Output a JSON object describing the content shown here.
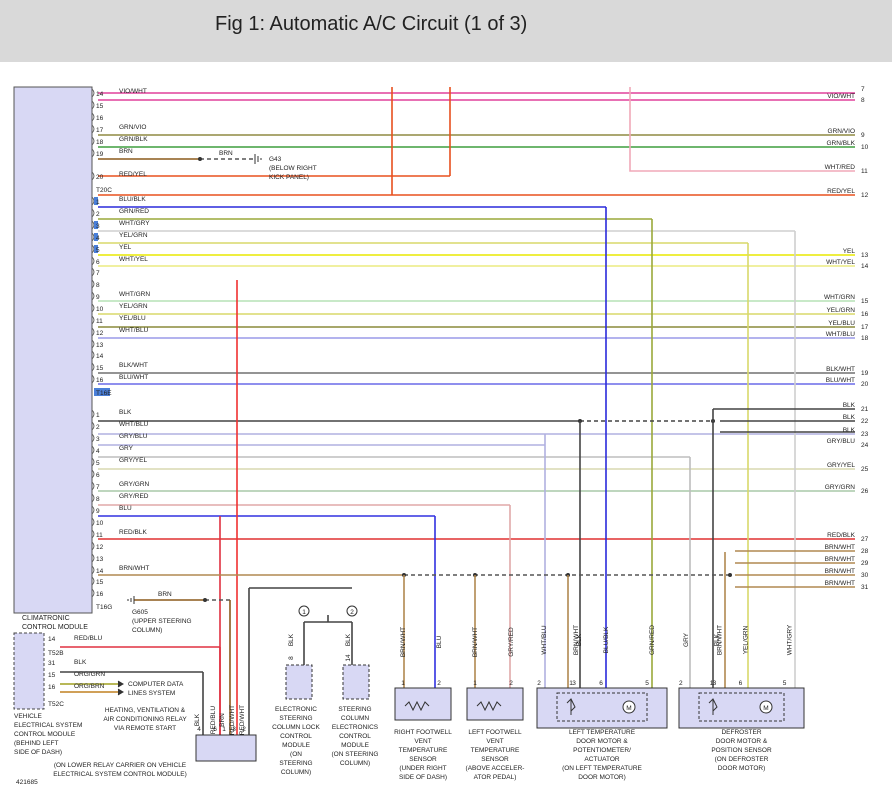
{
  "title": "Fig 1: Automatic A/C Circuit (1 of 3)",
  "figure_id": "421685",
  "colors": {
    "VIO/WHT": "#e0409c",
    "GRN/VIO": "#8f8a42",
    "GRN/BLK": "#3e9e3e",
    "BRN": "#8b5a1b",
    "RED/YEL": "#e8501e",
    "WHT/RED": "#f0a8b8",
    "BLU/BLK": "#2a2adb",
    "GRN/RED": "#9aa83a",
    "WHT/GRY": "#cfcfcf",
    "YEL/GRN": "#d8d86a",
    "YEL": "#e8e800",
    "WHT/YEL": "#ecec80",
    "WHT/GRN": "#b6e2b6",
    "YEL/GRY": "#d8d8a0",
    "YEL/BLU": "#8a8a3a",
    "WHT/BLU": "#9a9ae8",
    "BLK/WHT": "#707070",
    "BLU/WHT": "#6a6ae8",
    "BLK": "#444444",
    "GRY/BLU": "#b0b0e0",
    "GRY": "#bdbdbd",
    "GRY/YEL": "#d8d8b0",
    "GRY/GRN": "#a8c8a8",
    "GRY/RED": "#e0a8a8",
    "BLU": "#3030e0",
    "RED/BLK": "#e03030",
    "BRN/WHT": "#b08850",
    "RED/BLU": "#e03040",
    "RED/WHT": "#f03030",
    "ORG/GRN": "#a0a020",
    "ORG/BRN": "#c08020"
  },
  "module": {
    "name": [
      "CLIMATRONIC",
      "CONTROL MODULE"
    ],
    "connectors": [
      "T20C",
      "T16E",
      "T16G"
    ]
  },
  "left_pins": [
    {
      "pin": "14",
      "label": "VIO/WHT"
    },
    {
      "pin": "15",
      "label": ""
    },
    {
      "pin": "16",
      "label": ""
    },
    {
      "pin": "17",
      "label": "GRN/VIO"
    },
    {
      "pin": "18",
      "label": "GRN/BLK"
    },
    {
      "pin": "19",
      "label": "BRN"
    },
    {
      "pin": "20",
      "label": "RED/YEL"
    },
    {
      "pin": "1",
      "label": "BLU/BLK"
    },
    {
      "pin": "2",
      "label": "GRN/RED"
    },
    {
      "pin": "3",
      "label": "WHT/GRY"
    },
    {
      "pin": "4",
      "label": "YEL/GRN"
    },
    {
      "pin": "5",
      "label": "YEL"
    },
    {
      "pin": "6",
      "label": "WHT/YEL"
    },
    {
      "pin": "7",
      "label": ""
    },
    {
      "pin": "8",
      "label": ""
    },
    {
      "pin": "9",
      "label": "WHT/GRN"
    },
    {
      "pin": "10",
      "label": "YEL/GRN"
    },
    {
      "pin": "11",
      "label": "YEL/BLU"
    },
    {
      "pin": "12",
      "label": "WHT/BLU"
    },
    {
      "pin": "13",
      "label": ""
    },
    {
      "pin": "14",
      "label": ""
    },
    {
      "pin": "15",
      "label": "BLK/WHT"
    },
    {
      "pin": "16",
      "label": "BLU/WHT"
    },
    {
      "pin": "1",
      "label": "BLK"
    },
    {
      "pin": "2",
      "label": "WHT/BLU"
    },
    {
      "pin": "3",
      "label": "GRY/BLU"
    },
    {
      "pin": "4",
      "label": "GRY"
    },
    {
      "pin": "5",
      "label": "GRY/YEL"
    },
    {
      "pin": "6",
      "label": ""
    },
    {
      "pin": "7",
      "label": "GRY/GRN"
    },
    {
      "pin": "8",
      "label": "GRY/RED"
    },
    {
      "pin": "9",
      "label": "BLU"
    },
    {
      "pin": "10",
      "label": ""
    },
    {
      "pin": "11",
      "label": "RED/BLK"
    },
    {
      "pin": "12",
      "label": ""
    },
    {
      "pin": "13",
      "label": ""
    },
    {
      "pin": "14",
      "label": "BRN/WHT"
    },
    {
      "pin": "15",
      "label": ""
    },
    {
      "pin": "16",
      "label": ""
    }
  ],
  "right_refs": [
    {
      "num": "7",
      "label": ""
    },
    {
      "num": "8",
      "label": "VIO/WHT"
    },
    {
      "num": "9",
      "label": "GRN/VIO"
    },
    {
      "num": "10",
      "label": "GRN/BLK"
    },
    {
      "num": "11",
      "label": "WHT/RED"
    },
    {
      "num": "12",
      "label": "RED/YEL"
    },
    {
      "num": "13",
      "label": "YEL"
    },
    {
      "num": "14",
      "label": "WHT/YEL"
    },
    {
      "num": "15",
      "label": "WHT/GRN"
    },
    {
      "num": "16",
      "label": "YEL/GRN"
    },
    {
      "num": "17",
      "label": "YEL/BLU"
    },
    {
      "num": "18",
      "label": "WHT/BLU"
    },
    {
      "num": "19",
      "label": "BLK/WHT"
    },
    {
      "num": "20",
      "label": "BLU/WHT"
    },
    {
      "num": "21",
      "label": "BLK"
    },
    {
      "num": "22",
      "label": "BLK"
    },
    {
      "num": "23",
      "label": "BLK"
    },
    {
      "num": "24",
      "label": "GRY/BLU"
    },
    {
      "num": "25",
      "label": "GRY/YEL"
    },
    {
      "num": "26",
      "label": "GRY/GRN"
    },
    {
      "num": "27",
      "label": "RED/BLK"
    },
    {
      "num": "28",
      "label": "BRN/WHT"
    },
    {
      "num": "29",
      "label": "BRN/WHT"
    },
    {
      "num": "30",
      "label": "BRN/WHT"
    },
    {
      "num": "31",
      "label": "BRN/WHT"
    }
  ],
  "grounds": {
    "g43": {
      "wire": "BRN",
      "name": "G43",
      "location": [
        "(BELOW RIGHT",
        "KICK PANEL)"
      ]
    },
    "g605": {
      "wire": "BRN",
      "name": "G605",
      "location": [
        "(UPPER STEERING",
        "COLUMN)"
      ]
    }
  },
  "vecm": {
    "connectors": [
      "T52B",
      "T52C"
    ],
    "pins": [
      {
        "pin": "14",
        "label": "RED/BLU"
      },
      {
        "pin": "31",
        "label": "BLK"
      },
      {
        "pin": "15",
        "label": "ORG/GRN"
      },
      {
        "pin": "16",
        "label": "ORG/BRN"
      }
    ],
    "data_lines": "COMPUTER DATA LINES SYSTEM",
    "name": [
      "VEHICLE",
      "ELECTRICAL SYSTEM",
      "CONTROL MODULE",
      "(BEHIND LEFT",
      "SIDE OF DASH)"
    ]
  },
  "hvac_relay": {
    "pins": [
      {
        "pin": "4",
        "wire": "BLK"
      },
      {
        "pin": "6",
        "wire": "RED/BLU"
      },
      {
        "pin": "1",
        "wire": "BRN"
      },
      {
        "pin": "3",
        "wire": "RED/WHT"
      },
      {
        "pin": "2",
        "wire": "RED/WHT"
      }
    ],
    "name": [
      "HEATING, VENTILATION &",
      "AIR CONDITIONING RELAY",
      "VIA REMOTE START",
      "(ON LOWER RELAY CARRIER ON VEHICLE",
      "ELECTRICAL SYSTEM CONTROL MODULE)"
    ]
  },
  "steering_lock": {
    "pin": "8",
    "wire": "BLK",
    "name": [
      "ELECTRONIC",
      "STEERING",
      "COLUMN LOCK",
      "CONTROL",
      "MODULE",
      "(ON",
      "STEERING",
      "COLUMN)"
    ]
  },
  "steering_elec": {
    "pin": "14",
    "wire": "BLK",
    "name": [
      "STEERING",
      "COLUMN",
      "ELECTRONICS",
      "CONTROL",
      "MODULE",
      "(ON STEERING",
      "COLUMN)"
    ]
  },
  "splice_markers": [
    "1",
    "2"
  ],
  "right_vent": {
    "pins": [
      "1",
      "2"
    ],
    "wires": [
      "BRN/WHT",
      "BLU"
    ],
    "name": [
      "RIGHT FOOTWELL",
      "VENT",
      "TEMPERATURE",
      "SENSOR",
      "(UNDER RIGHT",
      "SIDE OF DASH)"
    ]
  },
  "left_vent": {
    "pins": [
      "1",
      "2"
    ],
    "wires": [
      "BRN/WHT",
      "GRY/RED"
    ],
    "name": [
      "LEFT FOOTWELL",
      "VENT",
      "TEMPERATURE",
      "SENSOR",
      "(ABOVE ACCELER-",
      "ATOR PEDAL)"
    ]
  },
  "left_temp_motor": {
    "pins": [
      "2",
      "1",
      "3",
      "6",
      "5"
    ],
    "wires": [
      "WHT/BLU",
      "BRN/WHT",
      "BLK",
      "BLU/BLK",
      "GRN/RED"
    ],
    "name": [
      "LEFT TEMPERATURE",
      "DOOR MOTOR &",
      "POTENTIOMETER/",
      "ACTUATOR",
      "(ON LEFT TEMPERATURE",
      "DOOR MOTOR)"
    ]
  },
  "defroster_motor": {
    "pins": [
      "2",
      "1",
      "3",
      "6",
      "5"
    ],
    "wires": [
      "GRY",
      "BLK",
      "BRN/WHT",
      "YEL/GRN",
      "WHT/GRY"
    ],
    "name": [
      "DEFROSTER",
      "DOOR MOTOR &",
      "POSITION SENSOR",
      "(ON DEFROSTER",
      "DOOR MOTOR)"
    ]
  },
  "motor_symbol": "M"
}
